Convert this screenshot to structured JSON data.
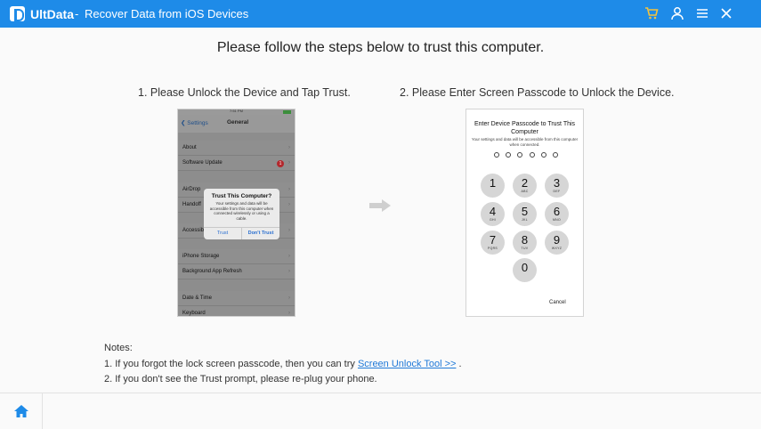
{
  "window": {
    "app_name": "UltData",
    "separator": "-",
    "subtitle": "Recover Data from iOS Devices",
    "icons": [
      "cart-icon",
      "user-icon",
      "menu-icon",
      "close-icon"
    ],
    "accent": "#1e8be8"
  },
  "main": {
    "title": "Please follow the steps below to trust this computer.",
    "step1_title": "1. Please Unlock the Device and Tap Trust.",
    "step2_title": "2. Please Enter Screen Passcode to Unlock the Device."
  },
  "phone1": {
    "time": "7:51 PM",
    "back": "❮ Settings",
    "header": "General",
    "rows": [
      "About",
      "Software Update",
      "AirDrop",
      "Handoff",
      "Accessibility",
      "iPhone Storage",
      "Background App Refresh",
      "Date & Time",
      "Keyboard"
    ],
    "badge": "1",
    "dialog_title": "Trust This Computer?",
    "dialog_body": "Your settings and data will be accessible from this computer when connected wirelessly or using a cable.",
    "trust_label": "Trust",
    "dont_trust_label": "Don't Trust"
  },
  "phone2": {
    "title": "Enter Device Passcode to Trust This Computer",
    "subtitle": "Your settings and data will be accessible from this computer when connected.",
    "keys": [
      {
        "n": "1",
        "l": ""
      },
      {
        "n": "2",
        "l": "ABC"
      },
      {
        "n": "3",
        "l": "DEF"
      },
      {
        "n": "4",
        "l": "GHI"
      },
      {
        "n": "5",
        "l": "JKL"
      },
      {
        "n": "6",
        "l": "MNO"
      },
      {
        "n": "7",
        "l": "PQRS"
      },
      {
        "n": "8",
        "l": "TUV"
      },
      {
        "n": "9",
        "l": "WXYZ"
      },
      {
        "n": "0",
        "l": ""
      }
    ],
    "cancel": "Cancel"
  },
  "notes": {
    "heading": "Notes:",
    "line1_prefix": "1. If you forgot the lock screen passcode, then you can try ",
    "line1_link": "Screen Unlock Tool >>",
    "line1_suffix": " .",
    "line2": "2. If you don't see the Trust prompt, please re-plug your phone."
  },
  "footer": {
    "home_icon": "home-icon"
  }
}
